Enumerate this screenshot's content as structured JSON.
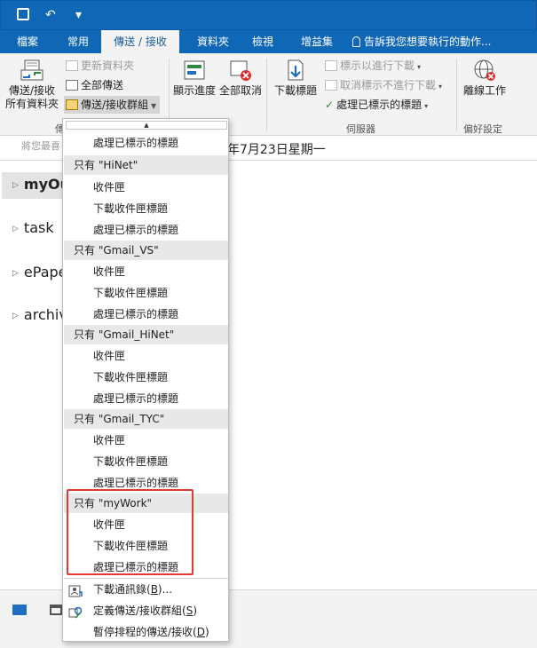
{
  "tabs": {
    "file": "檔案",
    "home": "常用",
    "send_receive": "傳送 / 接收",
    "folder": "資料夾",
    "view": "檢視",
    "addins": "增益集",
    "tell_me": "告訴我您想要執行的動作..."
  },
  "ribbon": {
    "send_all_folders_line1": "傳送/接收",
    "send_all_folders_line2": "所有資料夾",
    "update_folder": "更新資料夾",
    "send_all": "全部傳送",
    "send_receive_groups": "傳送/接收群組",
    "show_progress": "顯示進度",
    "cancel_all": "全部取消",
    "download_headers": "下載標題",
    "mark_to_download": "標示以進行下載",
    "unmark_to_download": "取消標示不進行下載",
    "process_marked_headers": "處理已標示的標題",
    "work_offline": "離線工作",
    "group_send_receive": "傳",
    "group_server": "伺服器",
    "group_preferences": "偏好設定"
  },
  "main": {
    "hint": "將您最喜",
    "date": "年7月23日星期一",
    "folders": [
      "myOu",
      "task",
      "ePape",
      "archive"
    ]
  },
  "menu": {
    "scroll_up": "▲",
    "first_item": "處理已標示的標題",
    "groups": [
      {
        "header": "只有 \"HiNet\"",
        "items": [
          "收件匣",
          "下載收件匣標題",
          "處理已標示的標題"
        ]
      },
      {
        "header": "只有 \"Gmail_VS\"",
        "items": [
          "收件匣",
          "下載收件匣標題",
          "處理已標示的標題"
        ]
      },
      {
        "header": "只有 \"Gmail_HiNet\"",
        "items": [
          "收件匣",
          "下載收件匣標題",
          "處理已標示的標題"
        ]
      },
      {
        "header": "只有 \"Gmail_TYC\"",
        "items": [
          "收件匣",
          "下載收件匣標題",
          "處理已標示的標題"
        ]
      },
      {
        "header": "只有 \"myWork\"",
        "items": [
          "收件匣",
          "下載收件匣標題",
          "處理已標示的標題"
        ]
      }
    ],
    "actions": [
      {
        "label": "下載通訊錄(",
        "key": "B",
        "suffix": ")..."
      },
      {
        "label": "定義傳送/接收群組(",
        "key": "S",
        "suffix": ")"
      },
      {
        "label": "暫停排程的傳送/接收(",
        "key": "D",
        "suffix": ")"
      }
    ]
  },
  "colors": {
    "accent": "#0f67b6",
    "highlight": "#e53935"
  }
}
